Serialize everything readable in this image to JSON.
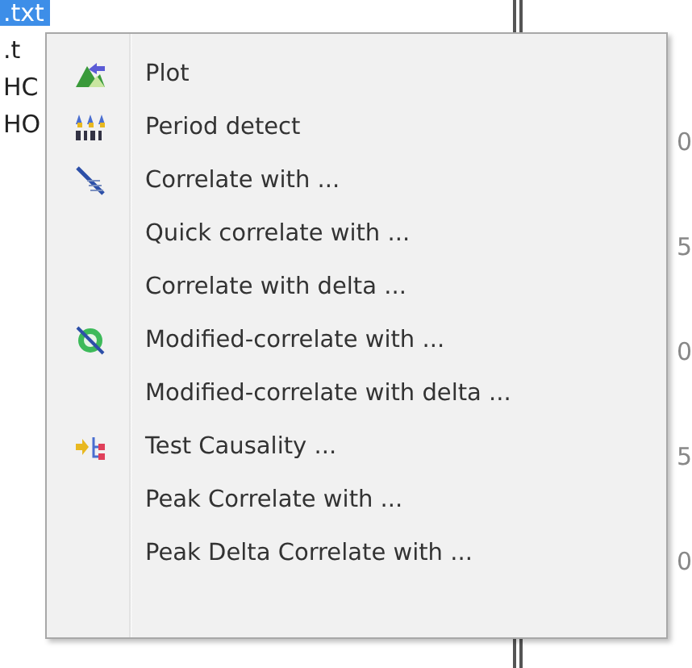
{
  "background": {
    "file_list": [
      {
        "label": ".txt",
        "selected": true
      },
      {
        "label": ".t",
        "selected": false
      },
      {
        "label": "HC",
        "selected": false
      },
      {
        "label": "HO",
        "selected": false
      }
    ],
    "axis_labels": [
      "0",
      "5",
      "0",
      "5",
      "0"
    ]
  },
  "context_menu": {
    "items": [
      {
        "label": "Plot",
        "kind": "plot"
      },
      {
        "label": "Period detect",
        "kind": "period"
      },
      {
        "label": "Correlate with ...",
        "kind": "correlate"
      },
      {
        "label": "Quick correlate with ...",
        "kind": "plain"
      },
      {
        "label": "Correlate with delta ...",
        "kind": "plain"
      },
      {
        "label": "Modified-correlate with ...",
        "kind": "modified"
      },
      {
        "label": "Modified-correlate with delta ...",
        "kind": "plain"
      },
      {
        "label": "Test Causality ...",
        "kind": "causality"
      },
      {
        "label": "Peak Correlate with ...",
        "kind": "plain"
      },
      {
        "label": "Peak Delta Correlate with ...",
        "kind": "plain"
      }
    ]
  }
}
